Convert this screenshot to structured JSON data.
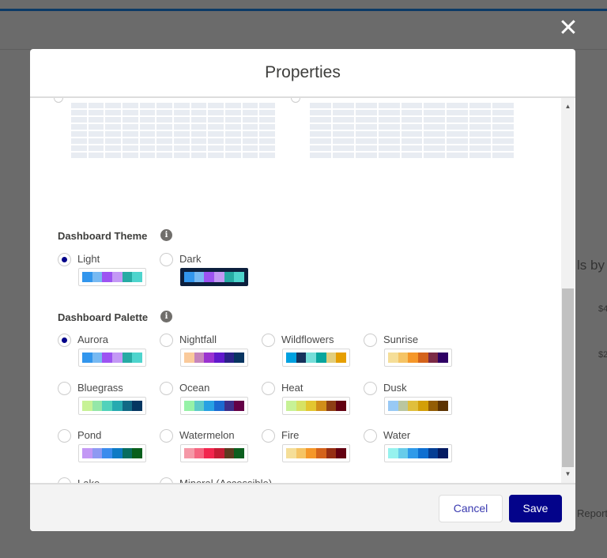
{
  "modal": {
    "title": "Properties",
    "cancel_label": "Cancel",
    "save_label": "Save"
  },
  "background": {
    "text1": "ls by",
    "text2": "$4",
    "text3": "$2",
    "text4": "Report"
  },
  "theme": {
    "heading": "Dashboard Theme",
    "options": [
      {
        "label": "Light",
        "selected": true,
        "colors": [
          "#3296ed",
          "#77b9f2",
          "#9d53f2",
          "#c398f5",
          "#26aba4",
          "#4ed4cd"
        ]
      },
      {
        "label": "Dark",
        "selected": false,
        "colors": [
          "#3296ed",
          "#77b9f2",
          "#9d53f2",
          "#c398f5",
          "#26aba4",
          "#4ed4cd"
        ]
      }
    ]
  },
  "palette": {
    "heading": "Dashboard Palette",
    "options": [
      {
        "label": "Aurora",
        "selected": true,
        "colors": [
          "#3296ed",
          "#77b9f2",
          "#9d53f2",
          "#c398f5",
          "#26aba4",
          "#4ed4cd"
        ]
      },
      {
        "label": "Nightfall",
        "selected": false,
        "colors": [
          "#faca9b",
          "#c685bc",
          "#9a32d0",
          "#6119cc",
          "#2b2388",
          "#083561"
        ]
      },
      {
        "label": "Wildflowers",
        "selected": false,
        "colors": [
          "#00a1e0",
          "#16325c",
          "#76ded9",
          "#08a69e",
          "#e2ce7d",
          "#e69f00"
        ]
      },
      {
        "label": "Sunrise",
        "selected": false,
        "colors": [
          "#f5de98",
          "#f5c465",
          "#f59729",
          "#d4631b",
          "#7c2b46",
          "#2f0064"
        ]
      },
      {
        "label": "Bluegrass",
        "selected": false,
        "colors": [
          "#c7f296",
          "#94e7a8",
          "#51d2bb",
          "#27aab0",
          "#116985",
          "#053661"
        ]
      },
      {
        "label": "Ocean",
        "selected": false,
        "colors": [
          "#96f2a7",
          "#5ecbc8",
          "#27a1e3",
          "#1b6ad1",
          "#3d2e8a",
          "#640046"
        ]
      },
      {
        "label": "Heat",
        "selected": false,
        "colors": [
          "#c7f296",
          "#d7e264",
          "#e3c630",
          "#d18e19",
          "#8e3e14",
          "#630011"
        ]
      },
      {
        "label": "Dusk",
        "selected": false,
        "colors": [
          "#98c9f5",
          "#bac6a0",
          "#e0bf3c",
          "#d39f08",
          "#935d05",
          "#5c3302"
        ]
      },
      {
        "label": "Pond",
        "selected": false,
        "colors": [
          "#c398f5",
          "#8e9af2",
          "#3b8ced",
          "#0d7ac4",
          "#086d60",
          "#095f1c"
        ]
      },
      {
        "label": "Watermelon",
        "selected": false,
        "colors": [
          "#f598a7",
          "#f56580",
          "#f2264e",
          "#c41c35",
          "#5c3a1f",
          "#0b5f1e"
        ]
      },
      {
        "label": "Fire",
        "selected": false,
        "colors": [
          "#f5de98",
          "#f5c465",
          "#f59729",
          "#d4631b",
          "#962f14",
          "#630011"
        ]
      },
      {
        "label": "Water",
        "selected": false,
        "colors": [
          "#96f2ee",
          "#68ccea",
          "#2f9ae9",
          "#0e6fd1",
          "#053e94",
          "#041b62"
        ]
      },
      {
        "label": "Lake",
        "selected": false,
        "colors": [
          "#98c9f5",
          "#72cbbe",
          "#44c971",
          "#36a83a",
          "#4e6115",
          "#5e3103"
        ]
      },
      {
        "label": "Mineral (Accessible)",
        "selected": false,
        "colors": [
          "#529ee0",
          "#d9a6c2",
          "#08916d",
          "#f59b00",
          "#006699",
          "#f0e442"
        ]
      }
    ]
  }
}
